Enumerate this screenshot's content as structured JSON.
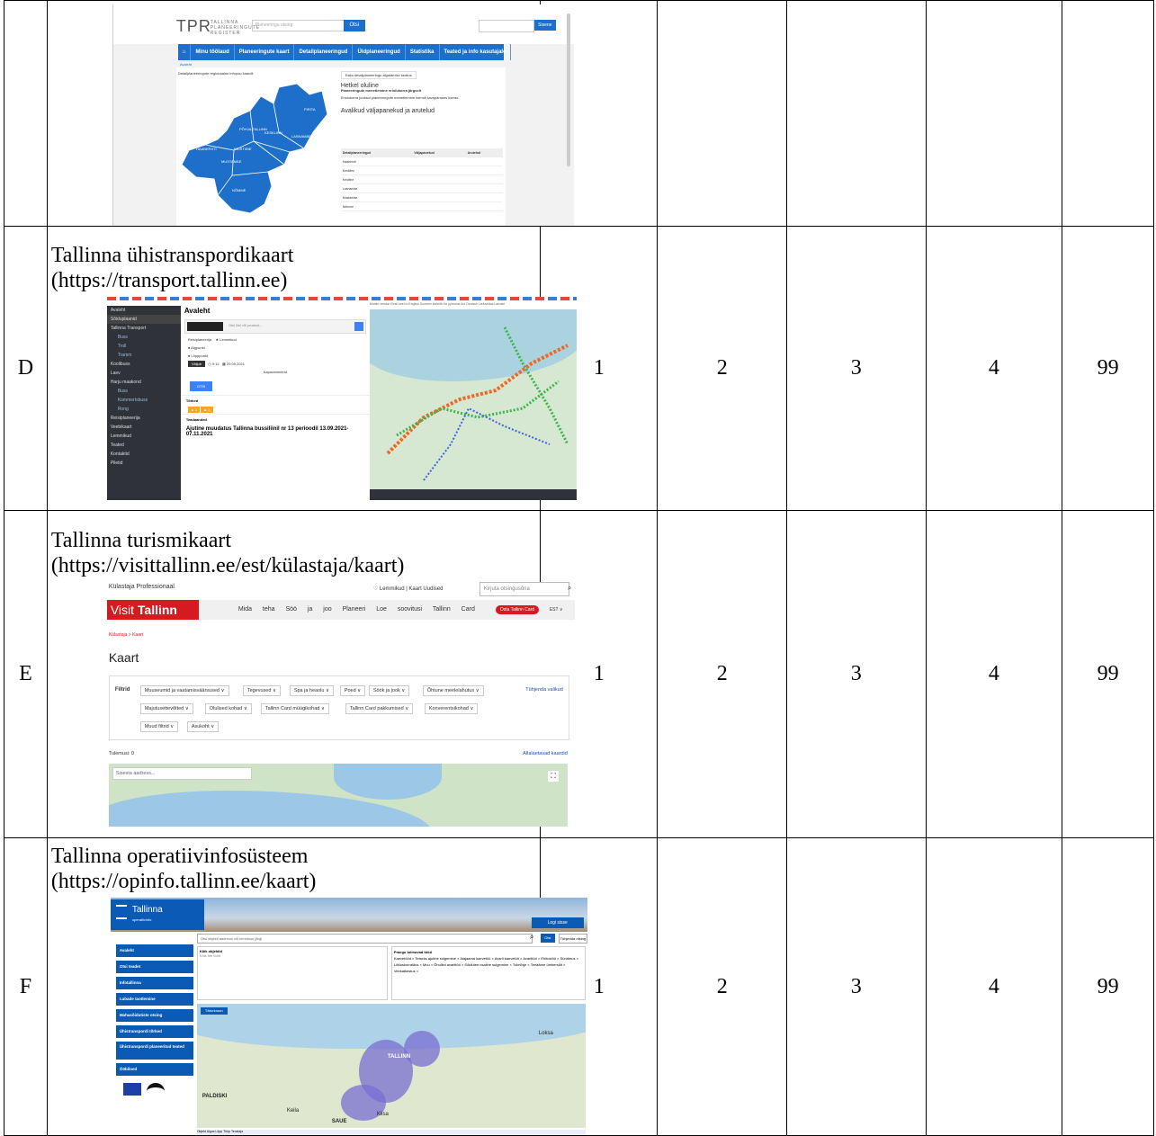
{
  "rows": [
    {
      "letter": "",
      "title": "",
      "url": "",
      "scores": [
        "",
        "",
        "",
        "",
        ""
      ],
      "screenshot": {
        "logo": "TPR",
        "logo_sub": "TALLINNA PLANEERINGUTE REGISTER",
        "search_placeholder": "Planeeringu otsing",
        "search_button": "Otsi",
        "login_button": "Sisene",
        "nav": [
          "Minu töölaud",
          "Planeeringute kaart",
          "Detailplaneeringud",
          "Üldplaneeringud",
          "Statistika",
          "Teated ja info kasutajale"
        ],
        "breadcrumb": "Avaleht",
        "left_header": "Detailplaneeringute regionaalne infopuu kaardil",
        "right_header": "Esita detailplaneeringu algatamise taotlus",
        "news_title": "Hetkel oluline",
        "news_sub": "Planeeringute menetlemine eriolukorra järgselt",
        "news_body": "Eriolukorra jooksul planeeringute menetlemine toimub tavapärases korras.",
        "section_title": "Avalikud väljapanekud ja arutelud",
        "table_header": [
          "Detailplaneeringud",
          "Väljapanekud",
          "Arutelud"
        ],
        "table_rows": [
          "Haabersti",
          "Kesklinn",
          "Kristiine",
          "Lasnamäe",
          "Mustamäe",
          "Nõmme"
        ],
        "districts": [
          "PIRITA",
          "PÕHJA-TALLINN",
          "KESKLINN",
          "LASNAMÄE",
          "HAABERSTI",
          "KRISTIINE",
          "MUSTAMÄE",
          "NÕMME"
        ]
      }
    },
    {
      "letter": "D",
      "title": "Tallinna ühistranspordikaart",
      "url": "(https://transport.tallinn.ee)",
      "scores": [
        "1",
        "2",
        "3",
        "4",
        "99"
      ],
      "screenshot": {
        "sidebar": [
          "Avaleht",
          "Sõiduplaanid",
          "Tallinna Transport",
          "Buss",
          "Troll",
          "Tramm",
          "Koolibuss",
          "Laev",
          "Harju maakond",
          "Buss",
          "Kommertsbuss",
          "Rong",
          "Reisiplaneerija",
          "Veebikaart",
          "Lemmikud",
          "Teated",
          "Kontaktid",
          "Piletid"
        ],
        "page_title": "Avaleht",
        "search_placeholder": "Otsi liini või peatust...",
        "tabs": [
          "Reisiplaneerija",
          "Lemmikud"
        ],
        "from_label": "Algpunkt",
        "to_label": "Lõpppunkt",
        "depart": "Väljub",
        "time": "9:12",
        "date": "20.09.2021",
        "params": "Kaparameetrid",
        "search_button": "OTSI",
        "disruptions": "Tõrked",
        "info": "Teadaanded",
        "news": "Ajutine muudatus Tallinna bussiliinil nr 13 perioodil 13.09.2021-07.11.2021",
        "top_links": "Mobile version  Eesti keel  In English  Suomen kielellä  На русском  Auf Deutsch  Lietuviškai  Latviski"
      }
    },
    {
      "letter": "E",
      "title": "Tallinna turismikaart",
      "url": "(https://visittallinn.ee/est/külastaja/kaart)",
      "scores": [
        "1",
        "2",
        "3",
        "4",
        "99"
      ],
      "screenshot": {
        "audience": "Külastaja   Professionaal",
        "top_links": "♡ Lemmikud  |  Kaart   Uudised",
        "search_placeholder": "Kirjuta otsingusõna",
        "logo_a": "Visit ",
        "logo_b": "Tallinn",
        "menu": "Mida teha   Söö ja joo   Planeeri   Loe soovitusi   Tallinn Card",
        "card_button": "Osta Tallinn Card",
        "lang": "EST ∨",
        "breadcrumb": "Külastaja  >  Kaart",
        "heading": "Kaart",
        "filters_label": "Filtrid",
        "chips": [
          "Muuseumid ja vaatamisväärsused ∨",
          "Tegevused ∨",
          "Spa ja heaolu ∨",
          "Poed ∨",
          "Söök ja jook ∨",
          "Õhtune meelelahutus ∨",
          "Majutusettevõtted ∨",
          "Olulised kohad ∨",
          "Tallinn Card müügikohad ∨",
          "Tallinn Card pakkumised ∨",
          "Konverentsikohad ∨",
          "Muud filtrid ∨",
          "Asukoht ∨"
        ],
        "clear": "Tühjenda valikud",
        "results": "Tulemusi: 0",
        "download": "Allalaetavad kaardid",
        "address_placeholder": "Sisesta aadress..."
      }
    },
    {
      "letter": "F",
      "title": "Tallinna operatiivinfosüsteem",
      "url": "(https://opinfo.tallinn.ee/kaart)",
      "scores": [
        "1",
        "2",
        "3",
        "4",
        "99"
      ],
      "screenshot": {
        "logo": "Tallinna",
        "logo_sub": "operatiivinfo",
        "login": "Logi sisse",
        "nav": [
          "Avaleht",
          "Otsi teadet",
          "Infotallinna",
          "Lubade taotlemine",
          "Mahasõidutiste otsing",
          "Ühistranspordi tõrked",
          "Ühistranspordi planeeritud teated",
          "Ööbiloed"
        ],
        "search_placeholder": "Otsi objekti aadressi või nimetuse järgi",
        "go": "Otsi",
        "clear": "Tühjenda otsing",
        "all_objects": "Kõik objektid",
        "sub": "Kõik tee tööd",
        "tags_title": "Praegu toimuvad tööd",
        "tags": "Kaevetööd × Teiseks ajutine sulgemine × Alajaama kaevetöö × Avarii kaevetöö × Avariitöö × Ehitustöö × Sündmus × Liikluskorraldus × Muu × Õhuliini avariitöö × Sõidutee osaline sulgemine × Tuletõrje × Teeäärne ümbersõit × Veekatkestus ×",
        "map_button": "Täisekraan",
        "map_labels": [
          "TALLINN",
          "PALDISKI",
          "SAUE",
          "Keila",
          "Kiisa",
          "Loksa"
        ],
        "table": "Objekt   Algus   Lõpp   Tüüp   Teostaja"
      }
    }
  ]
}
